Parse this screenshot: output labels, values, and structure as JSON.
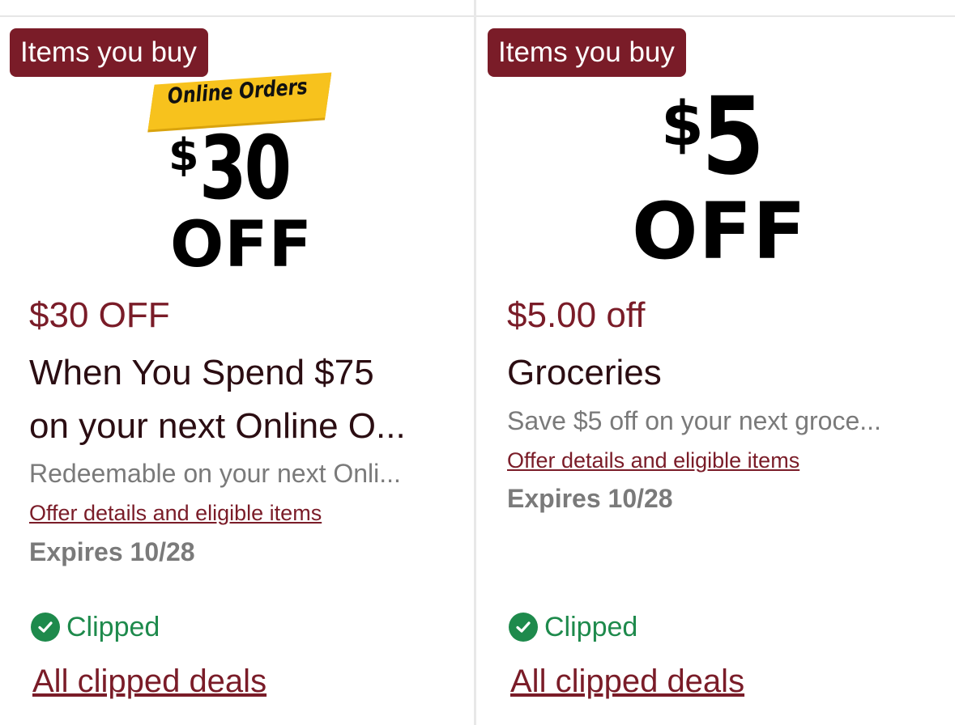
{
  "cards": [
    {
      "badge": "Items you buy",
      "hero": {
        "ribbon": "Online Orders",
        "dollar": "$",
        "amount": "30",
        "off": "OFF"
      },
      "price": "$30 OFF",
      "title_line1": "When You Spend $75",
      "title_line2": "on your next Online O...",
      "description": "Redeemable on your next Onli...",
      "offer_link": "Offer details and eligible items",
      "expires": "Expires 10/28",
      "status": "Clipped",
      "status_icon": "check-circle-icon",
      "all_link": "All clipped deals"
    },
    {
      "badge": "Items you buy",
      "hero": {
        "dollar": "$",
        "amount": "5",
        "off": "OFF"
      },
      "price": "$5.00 off",
      "title": "Groceries",
      "description": "Save $5 off on your next groce...",
      "offer_link": "Offer details and eligible items",
      "expires": "Expires 10/28",
      "status": "Clipped",
      "status_icon": "check-circle-icon",
      "all_link": "All clipped deals"
    }
  ],
  "colors": {
    "accent": "#7a1c28",
    "success": "#1e8a4c",
    "muted": "#7a7a7a",
    "ribbon": "#f7c21d"
  }
}
